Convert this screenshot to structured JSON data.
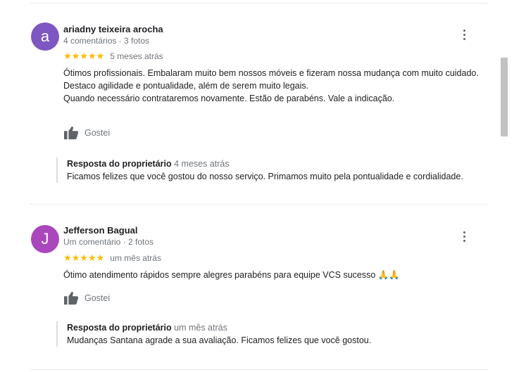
{
  "reviews": [
    {
      "avatar_letter": "a",
      "avatar_color": "#7e57c2",
      "name": "ariadny teixeira arocha",
      "meta": "4 comentários · 3 fotos",
      "stars": "★★★★★",
      "rating": 5,
      "date": "5 meses atrás",
      "text_lines": [
        "Ótimos profissionais. Embalaram muito bem nossos móveis e fizeram nossa mudança com muito cuidado.",
        "Destaco agilidade e pontualidade, além de serem muito legais.",
        "Quando necessário contrataremos novamente. Estão de parabéns. Vale a indicação."
      ],
      "like_label": "Gostei",
      "reply_title": "Resposta do proprietário",
      "reply_date": "4 meses atrás",
      "reply_text": "Ficamos felizes que você gostou do nosso serviço. Primamos muito pela pontualidade e cordialidade."
    },
    {
      "avatar_letter": "J",
      "avatar_color": "#ab47bc",
      "name": "Jefferson Bagual",
      "meta": "Um comentário · 2 fotos",
      "stars": "★★★★★",
      "rating": 5,
      "date": "um mês atrás",
      "text": "Ótimo atendimento rápidos sempre alegres parabéns para equipe VCS sucesso",
      "emoji": "🙏🙏",
      "like_label": "Gostei",
      "reply_title": "Resposta do proprietário",
      "reply_date": "um mês atrás",
      "reply_text": "Mudanças Santana agrade a sua avaliação. Ficamos felizes que você gostou."
    }
  ],
  "icons": {
    "like": "thumbs-up-icon",
    "menu": "more-vert-icon"
  },
  "colors": {
    "star": "#fbbc04",
    "meta_text": "#70757a",
    "divider": "#e8eaed"
  }
}
